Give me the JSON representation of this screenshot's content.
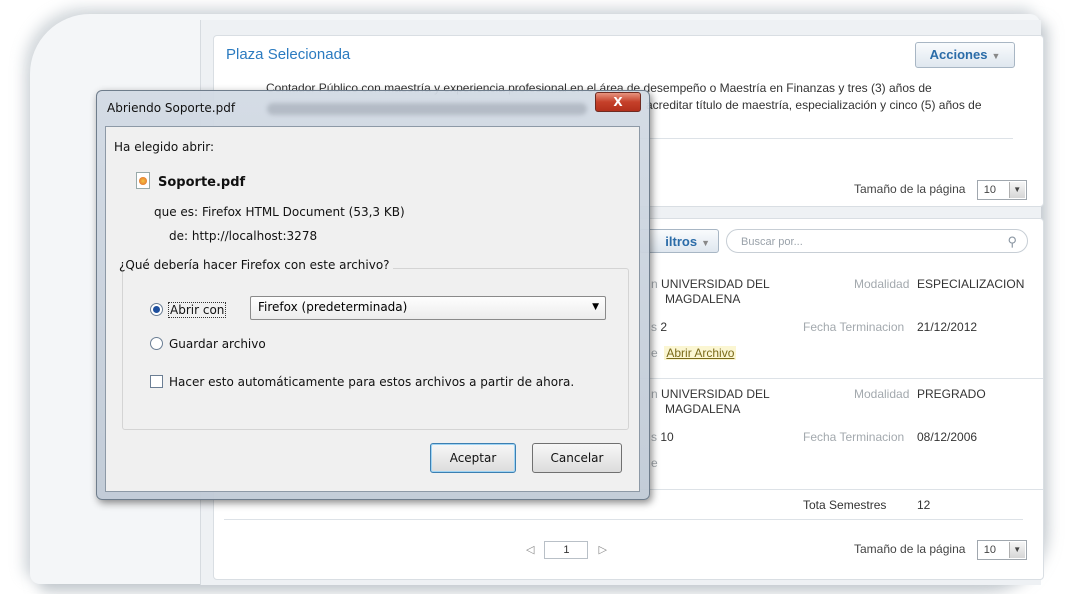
{
  "panel_top": {
    "title": "Plaza Selecionada",
    "actions_label": "Acciones",
    "description_line1": "Contador Público con maestría y experiencia profesional en el área de desempeño o Maestría en Finanzas y tres (3) años de",
    "description_line2": "acreditar título de maestría, especialización y cinco (5) años de",
    "page_size_label": "Tamaño de la página",
    "page_size_value": "10"
  },
  "panel_bottom": {
    "filters_label": "iltros",
    "search_placeholder": "Buscar por...",
    "records": [
      {
        "university_line1": "UNIVERSIDAD DEL",
        "university_line2": "MAGDALENA",
        "modalidad_label": "Modalidad",
        "modalidad_value": "ESPECIALIZACION",
        "semesters": "2",
        "fecha_label": "Fecha Terminacion",
        "fecha_value": "21/12/2012",
        "file_link": "Abrir Archivo"
      },
      {
        "university_line1": "UNIVERSIDAD DEL",
        "university_line2": "MAGDALENA",
        "modalidad_label": "Modalidad",
        "modalidad_value": "PREGRADO",
        "semesters": "10",
        "fecha_label": "Fecha Terminacion",
        "fecha_value": "08/12/2006"
      }
    ],
    "total_label": "Tota Semestres",
    "total_value": "12",
    "page_number": "1",
    "page_size_label": "Tamaño de la página",
    "page_size_value": "10"
  },
  "dialog": {
    "title": "Abriendo Soporte.pdf",
    "close_label": "X",
    "chose_open": "Ha elegido abrir:",
    "filename": "Soporte.pdf",
    "type_label": "que es:",
    "type_value": "Firefox HTML Document (53,3 KB)",
    "from_label": "de:",
    "from_value": "http://localhost:3278",
    "question": "¿Qué debería hacer Firefox con este archivo?",
    "open_with_label": "Abrir con",
    "open_with_value": "Firefox (predeterminada)",
    "save_label": "Guardar archivo",
    "auto_label": "Hacer esto automáticamente para estos archivos a partir de ahora.",
    "accept_label": "Aceptar",
    "cancel_label": "Cancelar"
  }
}
